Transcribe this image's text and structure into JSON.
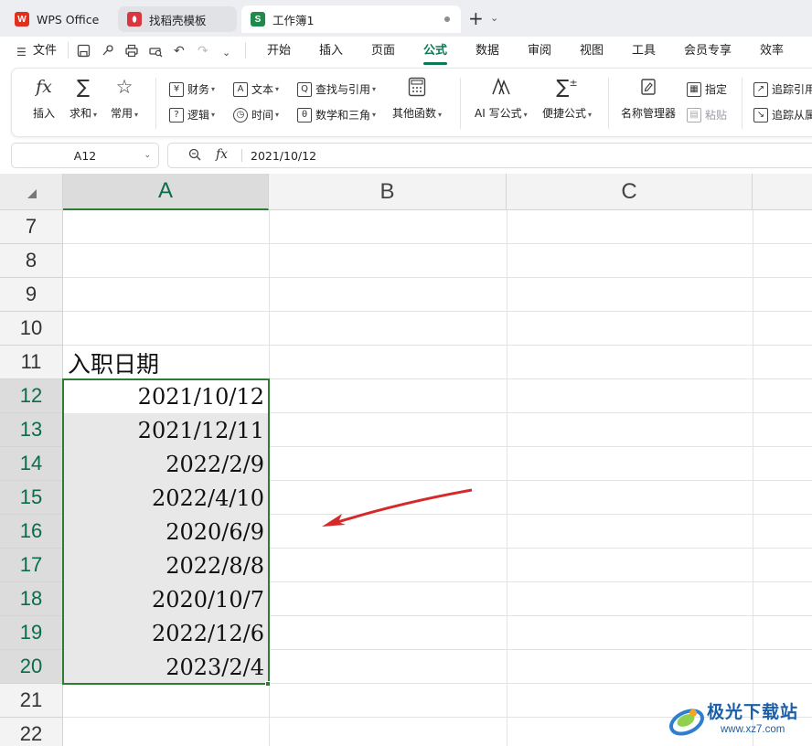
{
  "tabs": [
    {
      "label": "WPS Office",
      "icon": "wps-logo-icon",
      "icon_glyph": "W",
      "color": "#e0301e"
    },
    {
      "label": "找稻壳模板",
      "icon": "docer-icon",
      "icon_glyph": "",
      "color": "#d9363e"
    },
    {
      "label": "工作簿1",
      "icon": "spreadsheet-icon",
      "icon_glyph": "S",
      "color": "#1f8a4c"
    }
  ],
  "new_tab_symbol": "+",
  "quick_access": {
    "file_label": "文件"
  },
  "menu": {
    "items": [
      "开始",
      "插入",
      "页面",
      "公式",
      "数据",
      "审阅",
      "视图",
      "工具",
      "会员专享",
      "效率"
    ],
    "active": "公式",
    "accent_color": "#0b7a52"
  },
  "ribbon": {
    "insert_function": "插入",
    "sum": "求和",
    "common": "常用",
    "finance": "财务",
    "logic": "逻辑",
    "text": "文本",
    "time": "时间",
    "lookup": "查找与引用",
    "math": "数学和三角",
    "other_functions": "其他函数",
    "ai_formula": "AI 写公式",
    "quick_formula": "便捷公式",
    "name_manager": "名称管理器",
    "specify": "指定",
    "paste": "粘贴",
    "trace_precedents": "追踪引用",
    "trace_dependents": "追踪从属"
  },
  "formula_bar": {
    "cell_ref": "A12",
    "fx_label": "fx",
    "value": "2021/10/12"
  },
  "grid": {
    "columns": [
      "A",
      "B",
      "C"
    ],
    "selected_column": "A",
    "rows": [
      "7",
      "8",
      "9",
      "10",
      "11",
      "12",
      "13",
      "14",
      "15",
      "16",
      "17",
      "18",
      "19",
      "20",
      "21",
      "22"
    ],
    "selected_rows": [
      "12",
      "13",
      "14",
      "15",
      "16",
      "17",
      "18",
      "19",
      "20"
    ],
    "header_cell": {
      "row": "11",
      "value": "入职日期"
    },
    "date_cells": [
      {
        "row": "12",
        "value": "2021/10/12"
      },
      {
        "row": "13",
        "value": "2021/12/11"
      },
      {
        "row": "14",
        "value": "2022/2/9"
      },
      {
        "row": "15",
        "value": "2022/4/10"
      },
      {
        "row": "16",
        "value": "2020/6/9"
      },
      {
        "row": "17",
        "value": "2022/8/8"
      },
      {
        "row": "18",
        "value": "2020/10/7"
      },
      {
        "row": "19",
        "value": "2022/12/6"
      },
      {
        "row": "20",
        "value": "2023/2/4"
      }
    ],
    "selection_color": "#2e7d32",
    "arrow_color": "#d42a2a"
  },
  "watermark": {
    "title": "极光下载站",
    "url": "www.xz7.com"
  }
}
